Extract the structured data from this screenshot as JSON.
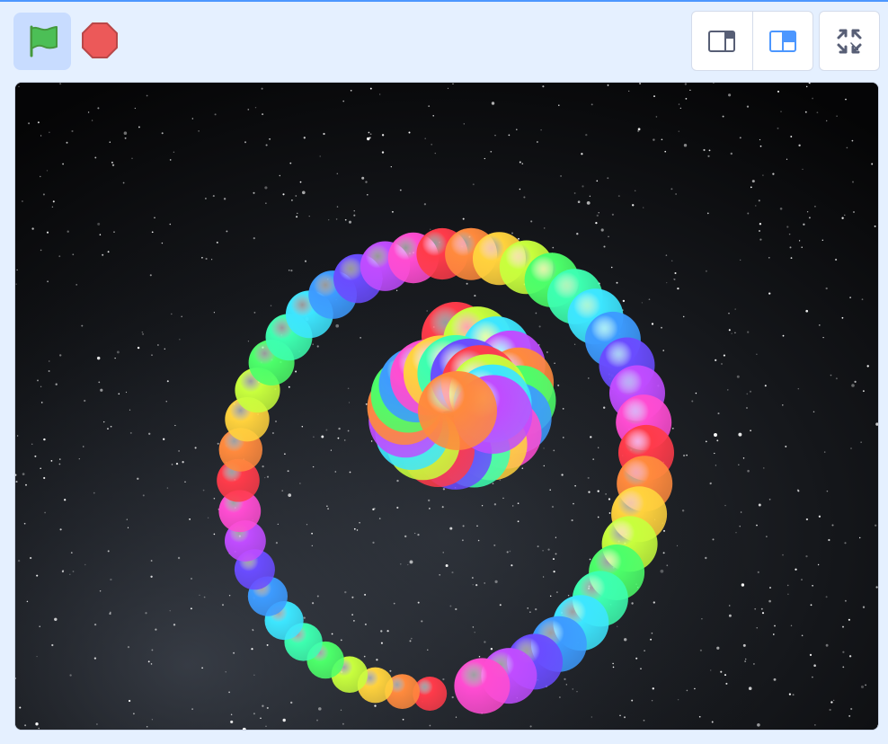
{
  "toolbar": {
    "controls": [
      {
        "name": "green-flag-button",
        "icon": "green-flag-icon",
        "active": true
      },
      {
        "name": "stop-button",
        "icon": "stop-icon"
      }
    ],
    "stage_modes": [
      {
        "name": "small-stage-button",
        "icon": "small-stage-icon",
        "selected": false
      },
      {
        "name": "large-stage-button",
        "icon": "large-stage-icon",
        "selected": true
      }
    ],
    "fullscreen": {
      "name": "fullscreen-button",
      "icon": "fullscreen-icon"
    }
  },
  "colors": {
    "accent": "#4c97ff",
    "background": "#e5f0ff",
    "flag_green": "#4cbf56",
    "stop_red": "#ec5959"
  },
  "stage": {
    "backdrop": "starfield",
    "sprite": "rainbow-ball-spiral",
    "ball_palette": [
      "#ff3b4a",
      "#ff8a3d",
      "#ffd23d",
      "#c8ff3d",
      "#4cff6a",
      "#3dffb0",
      "#3de6ff",
      "#3d9bff",
      "#6a4cff",
      "#c04cff",
      "#ff4cd2"
    ]
  }
}
